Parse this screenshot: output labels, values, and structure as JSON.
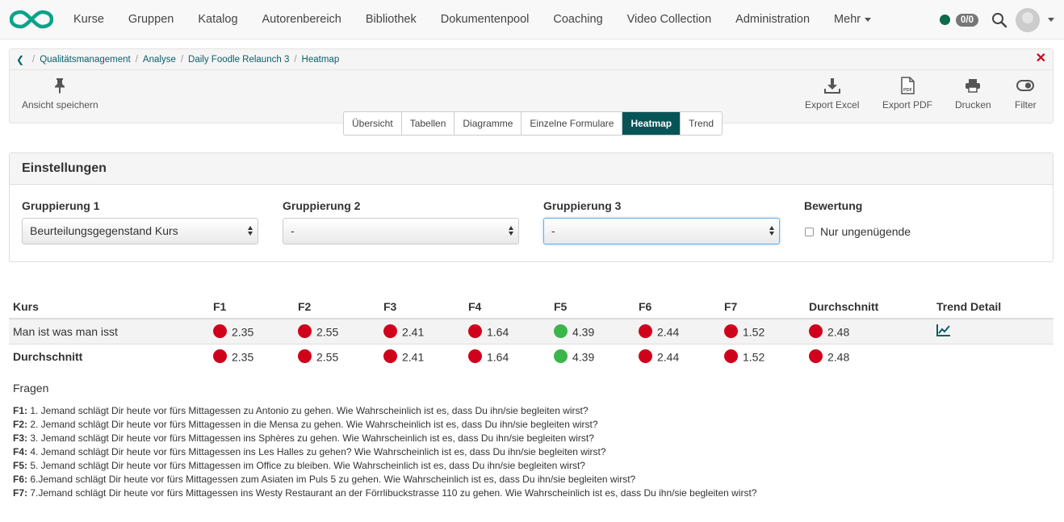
{
  "nav": {
    "items": [
      "Kurse",
      "Gruppen",
      "Katalog",
      "Autorenbereich",
      "Bibliothek",
      "Dokumentenpool",
      "Coaching",
      "Video Collection",
      "Administration",
      "Mehr"
    ],
    "badge": "0/0",
    "status_color": "#0a6b4d"
  },
  "breadcrumb": {
    "items": [
      "Qualitätsmanagement",
      "Analyse",
      "Daily Foodle Relaunch 3",
      "Heatmap"
    ]
  },
  "toolbar": {
    "save_view": "Ansicht speichern",
    "export_excel": "Export Excel",
    "export_pdf": "Export PDF",
    "print": "Drucken",
    "filter": "Filter"
  },
  "tabs": {
    "items": [
      "Übersicht",
      "Tabellen",
      "Diagramme",
      "Einzelne Formulare",
      "Heatmap",
      "Trend"
    ],
    "active": "Heatmap",
    "active_color": "#075457"
  },
  "settings": {
    "title": "Einstellungen",
    "group1": {
      "label": "Gruppierung 1",
      "value": "Beurteilungsgegenstand Kurs"
    },
    "group2": {
      "label": "Gruppierung 2",
      "value": "-"
    },
    "group3": {
      "label": "Gruppierung 3",
      "value": "-"
    },
    "rating": {
      "label": "Bewertung",
      "checkbox_label": "Nur ungenügende"
    }
  },
  "heatmap": {
    "columns": [
      "Kurs",
      "F1",
      "F2",
      "F3",
      "F4",
      "F5",
      "F6",
      "F7",
      "Durchschnitt",
      "Trend Detail"
    ],
    "rows": [
      {
        "name": "Man ist was man isst",
        "values": [
          "2.35",
          "2.55",
          "2.41",
          "1.64",
          "4.39",
          "2.44",
          "1.52",
          "2.48"
        ],
        "status": [
          "bad",
          "bad",
          "bad",
          "bad",
          "good",
          "bad",
          "bad",
          "bad"
        ]
      },
      {
        "name": "Durchschnitt",
        "values": [
          "2.35",
          "2.55",
          "2.41",
          "1.64",
          "4.39",
          "2.44",
          "1.52",
          "2.48"
        ],
        "status": [
          "bad",
          "bad",
          "bad",
          "bad",
          "good",
          "bad",
          "bad",
          "bad"
        ]
      }
    ],
    "colors": {
      "bad": "#d0021b",
      "good": "#3cb54a"
    }
  },
  "fragen": {
    "title": "Fragen",
    "items": [
      {
        "key": "F1:",
        "text": " 1. Jemand schlägt Dir heute vor fürs Mittagessen zu Antonio zu gehen. Wie Wahrscheinlich ist es, dass Du ihn/sie begleiten wirst?"
      },
      {
        "key": "F2:",
        "text": " 2. Jemand schlägt Dir heute vor fürs Mittagessen in die Mensa zu gehen. Wie Wahrscheinlich ist es, dass Du ihn/sie begleiten wirst?"
      },
      {
        "key": "F3:",
        "text": " 3. Jemand schlägt Dir heute vor fürs Mittagessen ins Sphères zu gehen. Wie Wahrscheinlich ist es, dass Du ihn/sie begleiten wirst?"
      },
      {
        "key": "F4:",
        "text": " 4. Jemand schlägt Dir heute vor fürs Mittagessen ins Les Halles zu gehen? Wie Wahrscheinlich ist es, dass Du ihn/sie begleiten wirst?"
      },
      {
        "key": "F5:",
        "text": " 5. Jemand schlägt Dir heute vor fürs Mittagessen im Office zu bleiben. Wie Wahrscheinlich ist es, dass Du ihn/sie begleiten wirst?"
      },
      {
        "key": "F6:",
        "text": " 6.Jemand schlägt Dir heute vor fürs Mittagessen zum Asiaten im Puls 5 zu gehen. Wie Wahrscheinlich ist es, dass Du ihn/sie begleiten wirst?"
      },
      {
        "key": "F7:",
        "text": " 7.Jemand schlägt Dir heute vor fürs Mittagessen ins Westy Restaurant an der Förrlibuckstrasse 110 zu gehen. Wie Wahrscheinlich ist es, dass Du ihn/sie begleiten wirst?"
      }
    ]
  }
}
